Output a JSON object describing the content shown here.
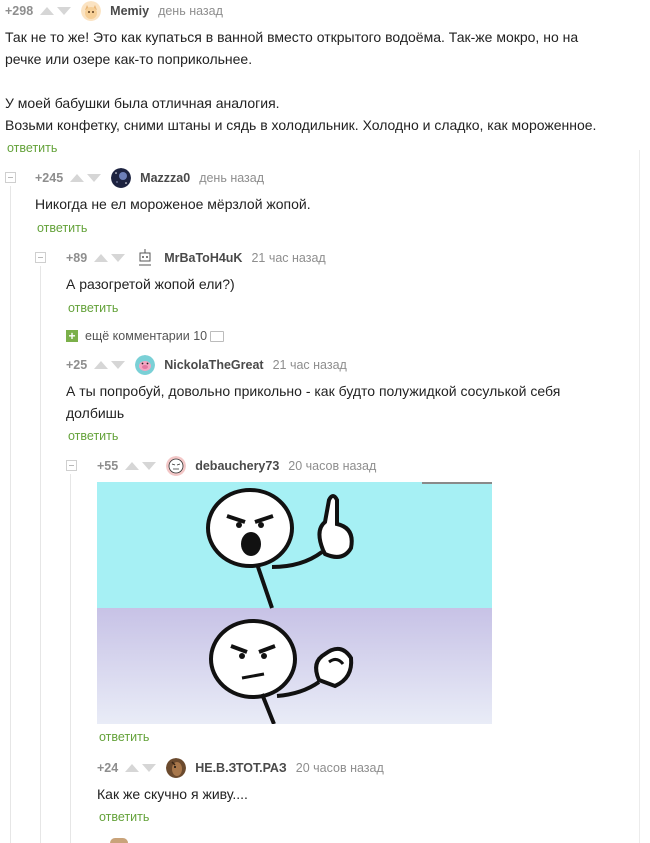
{
  "reply_label": "ответить",
  "colors": {
    "accent": "#64a23a",
    "meta": "#8e8e8e",
    "thread_line": "#e6e6e6"
  },
  "comments": [
    {
      "rating": "+298",
      "user": "Memiy",
      "time": "день назад",
      "avatar": "cat-avatar",
      "lines": [
        "Так не то же! Это как купаться в ванной вместо открытого водоёма. Так-же мокро, но на",
        "речке или озере как-то поприкольнее.",
        "",
        "У моей бабушки была отличная аналогия.",
        "Возьми конфетку, сними штаны и сядь в холодильник. Холодно и сладко, как мороженное."
      ]
    },
    {
      "rating": "+245",
      "user": "Mazzza0",
      "time": "день назад",
      "avatar": "space-avatar",
      "lines": [
        "Никогда не ел мороженое мёрзлой жопой."
      ]
    },
    {
      "rating": "+89",
      "user": "MrBaToH4uK",
      "time": "21 час назад",
      "avatar": "robot-avatar",
      "lines": [
        "А разогретой жопой ели?)"
      ]
    },
    {
      "rating": "+25",
      "user": "NickolaTheGreat",
      "time": "21 час назад",
      "avatar": "pig-avatar",
      "lines": [
        "А ты попробуй, довольно прикольно - как будто полужидкой сосулькой себя",
        "долбишь"
      ]
    },
    {
      "rating": "+55",
      "user": "debauchery73",
      "time": "20 часов назад",
      "avatar": "meme-avatar",
      "lines": []
    },
    {
      "rating": "+24",
      "user": "НЕ.В.ЗТОТ.РАЗ",
      "time": "20 часов назад",
      "avatar": "horse-avatar",
      "lines": [
        "Как же скучно я живу...."
      ]
    }
  ],
  "more_comments": {
    "label": "ещё комментарии 10"
  },
  "meme_image": {
    "alt": "meme-comic"
  }
}
